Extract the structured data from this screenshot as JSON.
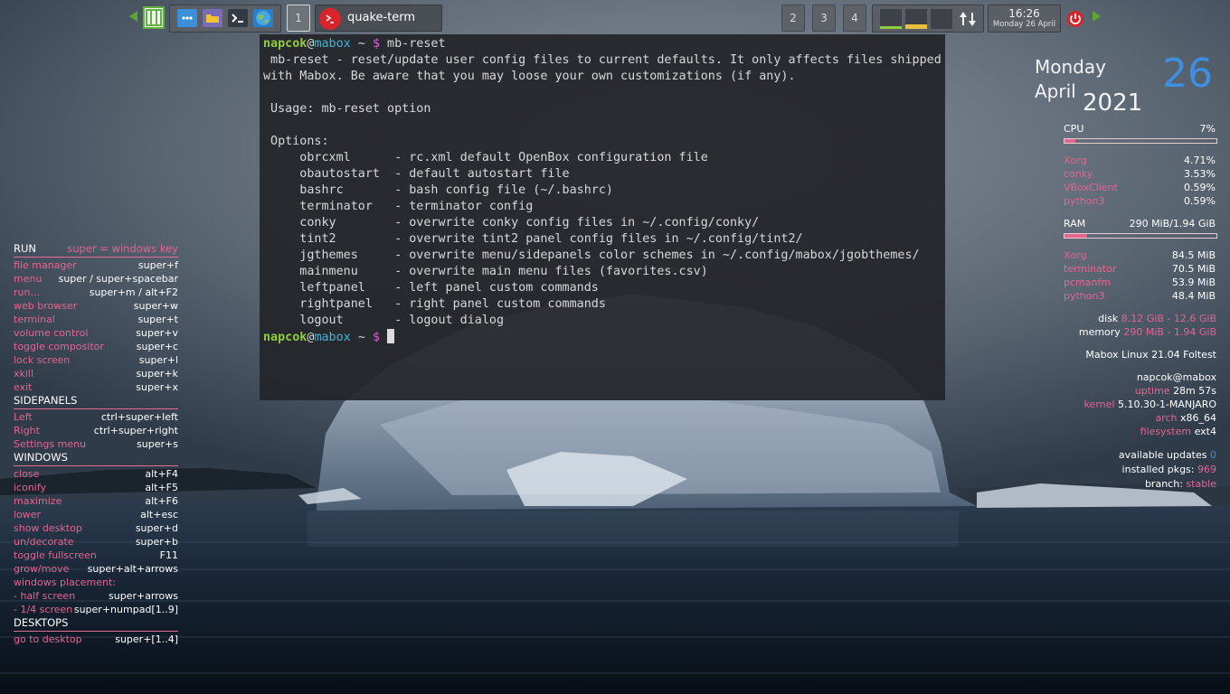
{
  "panel": {
    "task_label": "quake-term",
    "workspaces": [
      "1",
      "2",
      "3",
      "4"
    ],
    "clock_time": "16:26",
    "clock_date": "Monday 26 April"
  },
  "terminal": {
    "prompt": {
      "user": "napcok",
      "at": "@",
      "host": "mabox",
      "path": " ~ ",
      "symbol": "$"
    },
    "command": " mb-reset",
    "lines": [
      " mb-reset - reset/update user config files to current defaults. It only affects files shipped",
      "with Mabox. Be aware that you may loose your own customizations (if any).",
      "",
      " Usage: mb-reset option",
      "",
      " Options:",
      "     obrcxml      - rc.xml default OpenBox configuration file",
      "     obautostart  - default autostart file",
      "     bashrc       - bash config file (~/.bashrc)",
      "     terminator   - terminator config",
      "     conky        - overwrite conky config files in ~/.config/conky/",
      "     tint2        - overwrite tint2 panel config files in ~/.config/tint2/",
      "     jgthemes     - overwrite menu/sidepanels color schemes in ~/.config/mabox/jgobthemes/",
      "     mainmenu     - overwrite main menu files (favorites.csv)",
      "     leftpanel    - left panel custom commands",
      "     rightpanel   - right panel custom commands",
      "     logout       - logout dialog"
    ]
  },
  "keybinds": {
    "run": {
      "title": "RUN",
      "note": "super = windows key",
      "items": [
        {
          "label": "file manager",
          "keys": "super+f"
        },
        {
          "label": "menu",
          "keys": "super / super+spacebar"
        },
        {
          "label": "run...",
          "keys": "super+m / alt+F2"
        },
        {
          "label": "web browser",
          "keys": "super+w"
        },
        {
          "label": "terminal",
          "keys": "super+t"
        },
        {
          "label": "volume control",
          "keys": "super+v"
        },
        {
          "label": "toggle compositor",
          "keys": "super+c"
        },
        {
          "label": "lock screen",
          "keys": "super+l"
        },
        {
          "label": "xkill",
          "keys": "super+k"
        },
        {
          "label": "exit",
          "keys": "super+x"
        }
      ]
    },
    "sidepanels": {
      "title": "SIDEPANELS",
      "items": [
        {
          "label": "Left",
          "keys": "ctrl+super+left"
        },
        {
          "label": "Right",
          "keys": "ctrl+super+right"
        },
        {
          "label": "Settings menu",
          "keys": "super+s"
        }
      ]
    },
    "windows": {
      "title": "WINDOWS",
      "items": [
        {
          "label": "close",
          "keys": "alt+F4"
        },
        {
          "label": "iconify",
          "keys": "alt+F5"
        },
        {
          "label": "maximize",
          "keys": "alt+F6"
        },
        {
          "label": "lower",
          "keys": "alt+esc"
        },
        {
          "label": "show desktop",
          "keys": "super+d"
        },
        {
          "label": "un/decorate",
          "keys": "super+b"
        },
        {
          "label": "toggle fullscreen",
          "keys": "F11"
        },
        {
          "label": "grow/move",
          "keys": "super+alt+arrows"
        },
        {
          "label": "windows placement:",
          "keys": ""
        },
        {
          "label": " - half screen",
          "keys": "super+arrows"
        },
        {
          "label": " - 1/4 screen",
          "keys": "super+numpad[1..9]"
        }
      ]
    },
    "desktops": {
      "title": "DESKTOPS",
      "items": [
        {
          "label": "go to desktop",
          "keys": "super+[1..4]"
        }
      ]
    }
  },
  "conky": {
    "day": "Monday",
    "month": "April",
    "year": "2021",
    "date_num": "26",
    "cpu_label": "CPU",
    "cpu_value": "7%",
    "cpu_fraction": 0.07,
    "cpu_procs": [
      {
        "name": "Xorg",
        "value": "4.71%"
      },
      {
        "name": "conky",
        "value": "3.53%"
      },
      {
        "name": "VBoxClient",
        "value": "0.59%"
      },
      {
        "name": "python3",
        "value": "0.59%"
      }
    ],
    "ram_label": "RAM",
    "ram_value": "290 MiB/1.94 GiB",
    "ram_fraction": 0.15,
    "ram_procs": [
      {
        "name": "Xorg",
        "value": "84.5 MiB"
      },
      {
        "name": "terminator",
        "value": "70.5 MiB"
      },
      {
        "name": "pcmanfm",
        "value": "53.9 MiB"
      },
      {
        "name": "python3",
        "value": "48.4 MiB"
      }
    ],
    "disk_label": "disk",
    "disk_value": "8.12 GiB - 12.6 GiB",
    "memory_label": "memory",
    "memory_value": "290 MiB - 1.94 GiB",
    "distro": "Mabox Linux 21.04 Foltest",
    "user_host": "napcok@mabox",
    "uptime_label": "uptime",
    "uptime_value": "28m 57s",
    "kernel_label": "kernel",
    "kernel_value": "5.10.30-1-MANJARO",
    "arch_label": "arch",
    "arch_value": "x86_64",
    "fs_label": "filesystem",
    "fs_value": "ext4",
    "updates_label": "available updates",
    "updates_value": "0",
    "pkgs_label": "installed pkgs:",
    "pkgs_value": "969",
    "branch_label": "branch:",
    "branch_value": "stable"
  },
  "colors": {
    "accent_pink": "#e36590",
    "prompt_green": "#8fce39",
    "prompt_cyan": "#3fb6d8",
    "date_blue": "#3f8fe0"
  }
}
